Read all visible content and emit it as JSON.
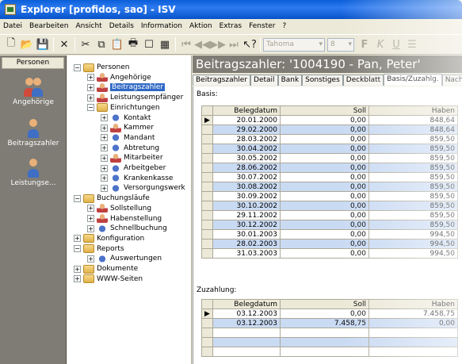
{
  "window": {
    "title": "Explorer [profidos, sao] - ISV"
  },
  "menu": [
    "Datei",
    "Bearbeiten",
    "Ansicht",
    "Details",
    "Information",
    "Aktion",
    "Extras",
    "Fenster",
    "?"
  ],
  "toolbar": {
    "font": "Tahoma",
    "size": "8",
    "format_labels": [
      "F",
      "K",
      "U"
    ]
  },
  "leftbar": {
    "header": "Personen",
    "items": [
      "Angehörige",
      "Beitragszahler",
      "Leistungse..."
    ]
  },
  "tree": [
    {
      "label": "Personen",
      "level": 0,
      "type": "folder",
      "toggle": "−"
    },
    {
      "label": "Angehörige",
      "level": 1,
      "type": "person",
      "toggle": "+"
    },
    {
      "label": "Beitragszahler",
      "level": 1,
      "type": "person",
      "toggle": "+",
      "selected": true
    },
    {
      "label": "Leistungsempfänger",
      "level": 1,
      "type": "person",
      "toggle": "+"
    },
    {
      "label": "Einrichtungen",
      "level": 1,
      "type": "folder",
      "toggle": "−"
    },
    {
      "label": "Kontakt",
      "level": 2,
      "type": "gear",
      "toggle": "+"
    },
    {
      "label": "Kammer",
      "level": 2,
      "type": "person",
      "toggle": "+"
    },
    {
      "label": "Mandant",
      "level": 2,
      "type": "gear",
      "toggle": "+"
    },
    {
      "label": "Abtretung",
      "level": 2,
      "type": "gear",
      "toggle": "+"
    },
    {
      "label": "Mitarbeiter",
      "level": 2,
      "type": "person",
      "toggle": "+"
    },
    {
      "label": "Arbeitgeber",
      "level": 2,
      "type": "gear",
      "toggle": "+"
    },
    {
      "label": "Krankenkasse",
      "level": 2,
      "type": "gear",
      "toggle": "+"
    },
    {
      "label": "Versorgungswerk",
      "level": 2,
      "type": "gear",
      "toggle": "+"
    },
    {
      "label": "Buchungsläufe",
      "level": 0,
      "type": "folder",
      "toggle": "−"
    },
    {
      "label": "Sollstellung",
      "level": 1,
      "type": "person",
      "toggle": "+"
    },
    {
      "label": "Habenstellung",
      "level": 1,
      "type": "person",
      "toggle": "+"
    },
    {
      "label": "Schnellbuchung",
      "level": 1,
      "type": "gear",
      "toggle": "+"
    },
    {
      "label": "Konfiguration",
      "level": 0,
      "type": "folder",
      "toggle": "+"
    },
    {
      "label": "Reports",
      "level": 0,
      "type": "folder",
      "toggle": "−"
    },
    {
      "label": "Auswertungen",
      "level": 1,
      "type": "gear",
      "toggle": "+"
    },
    {
      "label": "Dokumente",
      "level": 0,
      "type": "folder",
      "toggle": "+"
    },
    {
      "label": "WWW-Seiten",
      "level": 0,
      "type": "folder",
      "toggle": "+"
    }
  ],
  "record": {
    "title": "Beitragszahler: '1004190 - Pan, Peter'"
  },
  "tabs": [
    "Beitragszahler",
    "Detail",
    "Bank",
    "Sonstiges",
    "Deckblatt",
    "Basis/Zuzahlg.",
    "Nachv./Übe"
  ],
  "basis": {
    "label": "Basis:",
    "columns": [
      "Belegdatum",
      "Soll",
      "Haben"
    ],
    "rows": [
      [
        "20.01.2000",
        "0,00",
        "848,64"
      ],
      [
        "29.02.2000",
        "0,00",
        "848,64"
      ],
      [
        "28.03.2002",
        "0,00",
        "859,50"
      ],
      [
        "30.04.2002",
        "0,00",
        "859,50"
      ],
      [
        "30.05.2002",
        "0,00",
        "859,50"
      ],
      [
        "28.06.2002",
        "0,00",
        "859,50"
      ],
      [
        "30.07.2002",
        "0,00",
        "859,50"
      ],
      [
        "30.08.2002",
        "0,00",
        "859,50"
      ],
      [
        "30.09.2002",
        "0,00",
        "859,50"
      ],
      [
        "30.10.2002",
        "0,00",
        "859,50"
      ],
      [
        "29.11.2002",
        "0,00",
        "859,50"
      ],
      [
        "30.12.2002",
        "0,00",
        "859,50"
      ],
      [
        "30.01.2003",
        "0,00",
        "994,50"
      ],
      [
        "28.02.2003",
        "0,00",
        "994,50"
      ],
      [
        "31.03.2003",
        "0,00",
        "994,50"
      ]
    ]
  },
  "zuzahlung": {
    "label": "Zuzahlung:",
    "columns": [
      "Belegdatum",
      "Soll",
      "Haben"
    ],
    "rows": [
      [
        "03.12.2003",
        "0,00",
        "7.458,75"
      ],
      [
        "03.12.2003",
        "7.458,75",
        "0,00"
      ]
    ]
  }
}
